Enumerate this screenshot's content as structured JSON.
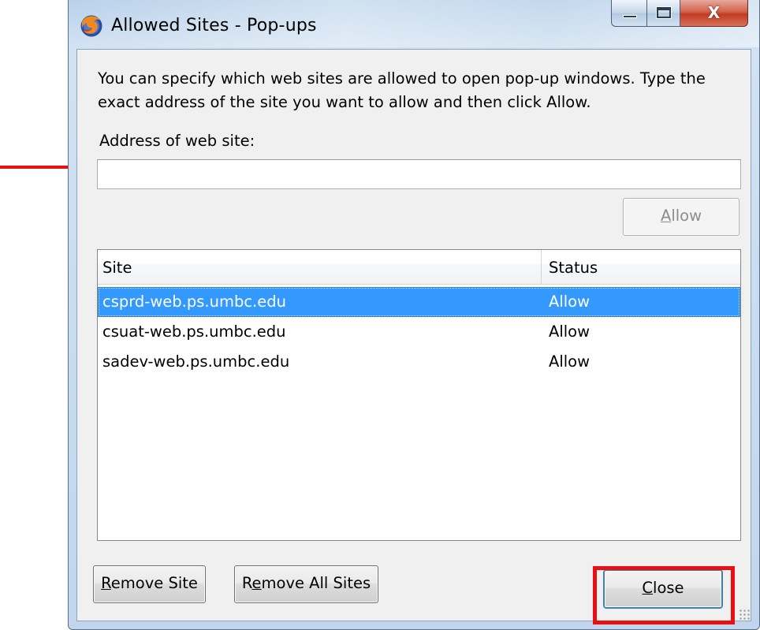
{
  "window": {
    "title": "Allowed Sites - Pop-ups",
    "caption_close": "X"
  },
  "description": "You can specify which web sites are allowed to open pop-up windows. Type the exact address of the site you want to allow and then click Allow.",
  "address": {
    "label": "Address of web site:",
    "value": "",
    "placeholder": ""
  },
  "allow_button": {
    "label_hotkey": "A",
    "label_rest": "llow",
    "enabled": false
  },
  "site_list": {
    "columns": [
      "Site",
      "Status"
    ],
    "rows": [
      {
        "site": "csprd-web.ps.umbc.edu",
        "status": "Allow",
        "selected": true
      },
      {
        "site": "csuat-web.ps.umbc.edu",
        "status": "Allow",
        "selected": false
      },
      {
        "site": "sadev-web.ps.umbc.edu",
        "status": "Allow",
        "selected": false
      }
    ]
  },
  "buttons": {
    "remove_site": {
      "hotkey": "R",
      "rest": "emove Site"
    },
    "remove_all_sites": {
      "pre": "R",
      "hotkey": "e",
      "rest": "move All Sites"
    },
    "close": {
      "hotkey": "C",
      "rest": "lose"
    }
  },
  "colors": {
    "selection": "#3399ff",
    "annotation": "#e81010"
  },
  "icons": {
    "app": "firefox-logo-icon",
    "minimize": "minimize-icon",
    "maximize": "maximize-icon",
    "close": "close-icon"
  }
}
